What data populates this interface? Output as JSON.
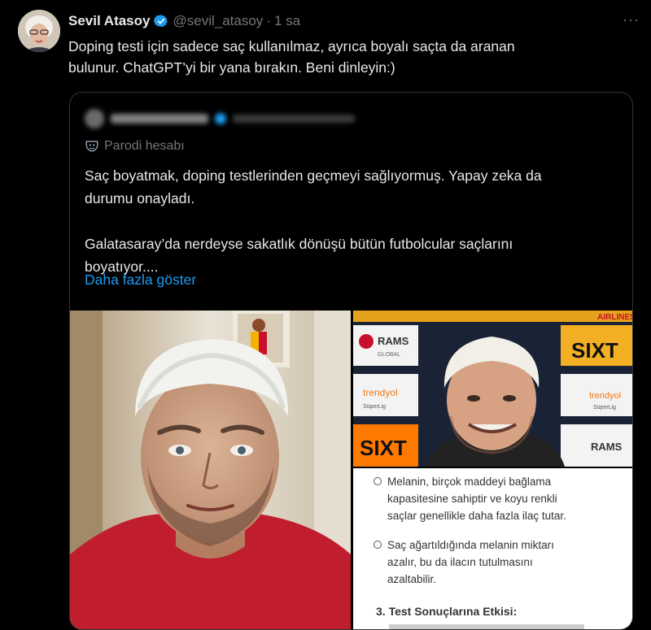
{
  "tweet": {
    "author_name": "Sevil Atasoy",
    "handle": "@sevil_atasoy",
    "separator": "·",
    "time": "1 sa",
    "more": "···",
    "text_line1": "Doping testi için sadece saç kullanılmaz, ayrıca boyalı saçta da aranan",
    "text_line2": "bulunur. ChatGPT’yi bir yana bırakın. Beni dinleyin:)"
  },
  "quoted": {
    "parody_label": "Parodi hesabı",
    "line1": "Saç boyatmak, doping testlerinden geçmeyi sağlıyormuş. Yapay zeka da",
    "line2": "durumu onayladı.",
    "line3": "Galatasaray’da nerdeyse sakatlık dönüşü bütün futbolcular saçlarını",
    "line4": "boyatıyor....",
    "show_more": "Daha fazla göster"
  },
  "images": {
    "sponsor_rams": "RAMS",
    "sponsor_global": "GLOBAL",
    "sponsor_trendyol": "trendyol",
    "sponsor_superlig": "SüperLig",
    "sponsor_sixt": "SIXT",
    "sponsor_airlines": "AIRLINES",
    "doc_bullet1_l1": "Melanin, birçok maddeyi bağlama",
    "doc_bullet1_l2": "kapasitesine sahiptir ve koyu renkli",
    "doc_bullet1_l3": "saçlar genellikle daha fazla ilaç tutar.",
    "doc_bullet2_l1": "Saç ağartıldığında melanin miktarı",
    "doc_bullet2_l2": "azalır, bu da ilacın tutulmasını",
    "doc_bullet2_l3": "azaltabilir.",
    "doc_heading": "3.  Test Sonuçlarına Etkisi:"
  },
  "colors": {
    "accent": "#1d9bf0",
    "background": "#000000",
    "text": "#e7e9ea",
    "muted": "#71767b",
    "border": "#2f3336"
  }
}
